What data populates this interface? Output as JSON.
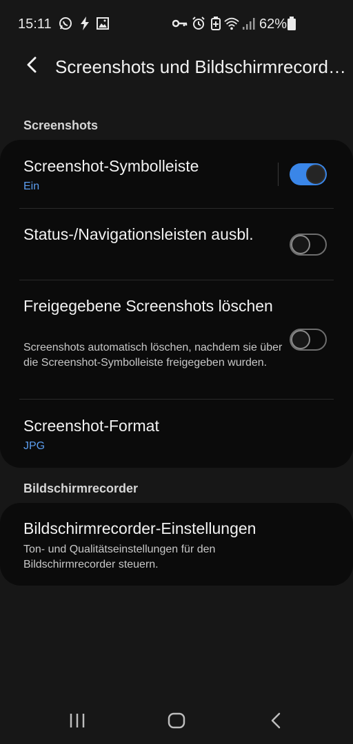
{
  "status_bar": {
    "time": "15:11",
    "battery": "62%"
  },
  "header": {
    "title": "Screenshots und Bildschirmrecord…"
  },
  "sections": {
    "screenshots_label": "Screenshots",
    "recorder_label": "Bildschirmrecorder"
  },
  "settings": {
    "toolbar": {
      "title": "Screenshot-Symbolleiste",
      "value": "Ein",
      "enabled": true
    },
    "hide_bars": {
      "title": "Status-/Navigationsleisten ausbl.",
      "enabled": false
    },
    "delete_shared": {
      "title": "Freigegebene Screenshots löschen",
      "description": "Screenshots automatisch löschen, nachdem sie über die Screenshot-Symbolleiste freigegeben wurden.",
      "enabled": false
    },
    "format": {
      "title": "Screenshot-Format",
      "value": "JPG"
    },
    "recorder": {
      "title": "Bildschirmrecorder-Einstellungen",
      "description": "Ton- und Qualitätseinstellungen für den Bildschirmrecorder steuern."
    }
  },
  "colors": {
    "accent": "#3a86e8",
    "value_text": "#5c9ef0",
    "background": "#171717",
    "card": "#0b0b0b"
  },
  "icons": [
    "whatsapp-icon",
    "flash-icon",
    "image-icon",
    "key-icon",
    "alarm-icon",
    "battery-saver-icon",
    "wifi-icon",
    "signal-icon",
    "battery-icon",
    "back-arrow-icon",
    "recent-apps-icon",
    "home-icon",
    "nav-back-icon"
  ]
}
